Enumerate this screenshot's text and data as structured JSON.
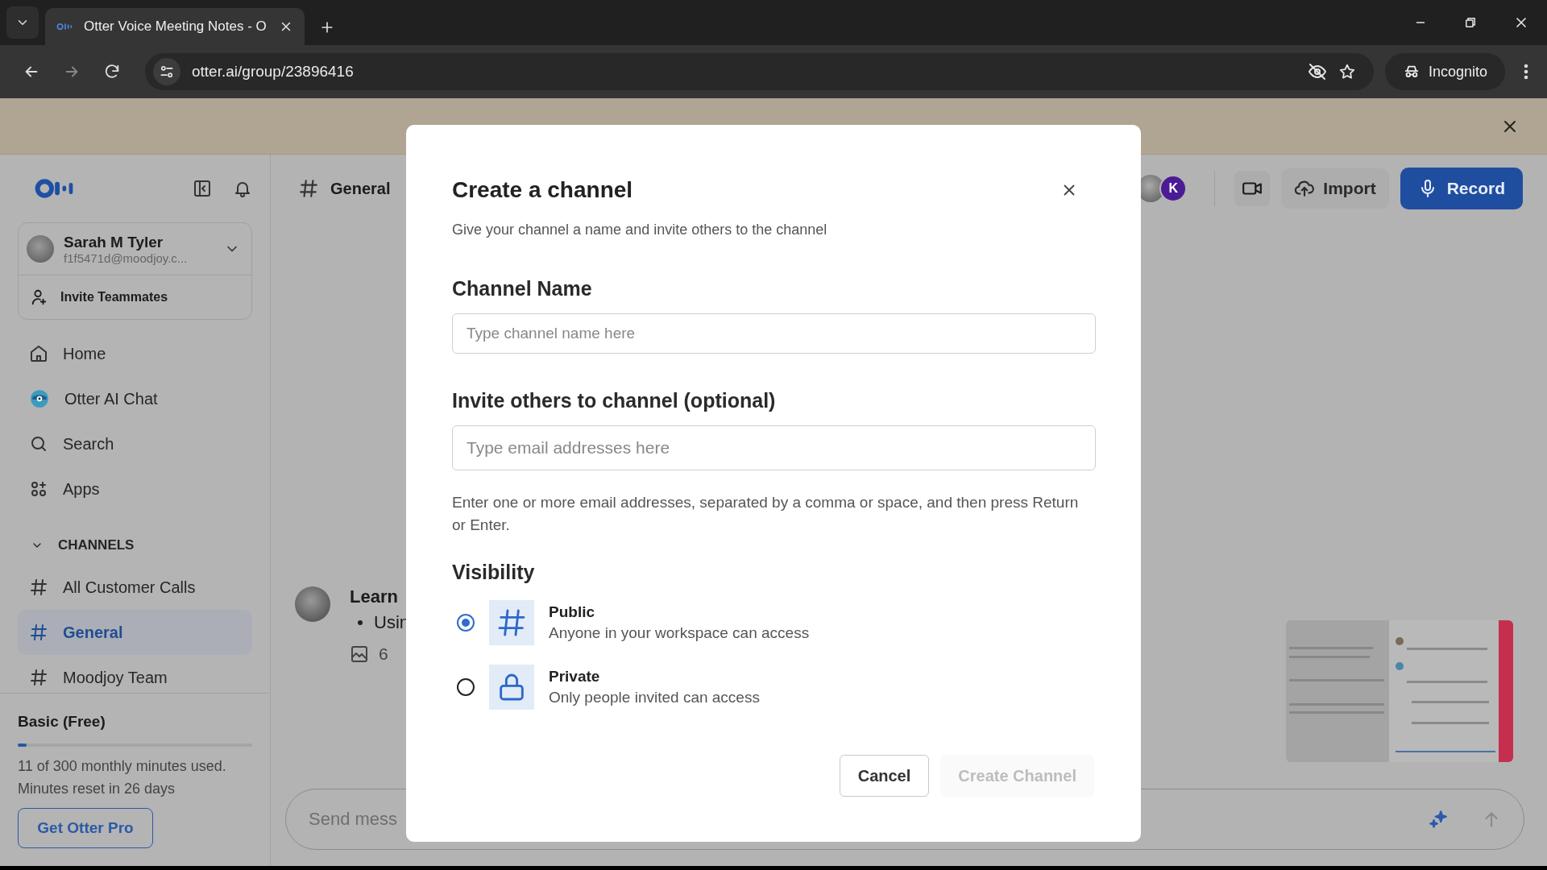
{
  "browser": {
    "tab_title": "Otter Voice Meeting Notes - O",
    "url": "otter.ai/group/23896416",
    "profile_label": "Incognito"
  },
  "sidebar": {
    "user": {
      "name": "Sarah M Tyler",
      "email": "f1f5471d@moodjoy.c..."
    },
    "invite": "Invite Teammates",
    "nav": [
      {
        "label": "Home"
      },
      {
        "label": "Otter AI Chat"
      },
      {
        "label": "Search"
      },
      {
        "label": "Apps"
      }
    ],
    "channels": {
      "heading": "CHANNELS",
      "expanded": true,
      "items": [
        {
          "label": "All Customer Calls",
          "selected": false
        },
        {
          "label": "General",
          "selected": true
        },
        {
          "label": "Moodjoy Team",
          "selected": false
        }
      ]
    },
    "plan": {
      "name": "Basic (Free)",
      "level": 0.037,
      "usage": "11 of 300 monthly minutes used.",
      "reset": "Minutes reset in 26 days",
      "upgrade_button": "Get Otter Pro"
    }
  },
  "main": {
    "channel": "General",
    "header_actions": {
      "avatar_initial": "K",
      "import": "Import",
      "record": "Record"
    },
    "message": {
      "title": "Learn",
      "bullet": "Usin",
      "image_count": "6"
    },
    "composer": {
      "placeholder": "Send mess"
    }
  },
  "modal": {
    "title": "Create a channel",
    "subtitle": "Give your channel a name and invite others to the channel",
    "name_label": "Channel Name",
    "name_placeholder": "Type channel name here",
    "invite_label": "Invite others to channel (optional)",
    "invite_placeholder": "Type email addresses here",
    "help": "Enter one or more email addresses, separated by a comma or space, and then press Return or Enter.",
    "visibility_label": "Visibility",
    "options": [
      {
        "title": "Public",
        "description": "Anyone in your workspace can access",
        "selected": true
      },
      {
        "title": "Private",
        "description": "Only people invited can access",
        "selected": false
      }
    ],
    "cancel": "Cancel",
    "create": {
      "label": "Create Channel",
      "disabled": true
    }
  }
}
